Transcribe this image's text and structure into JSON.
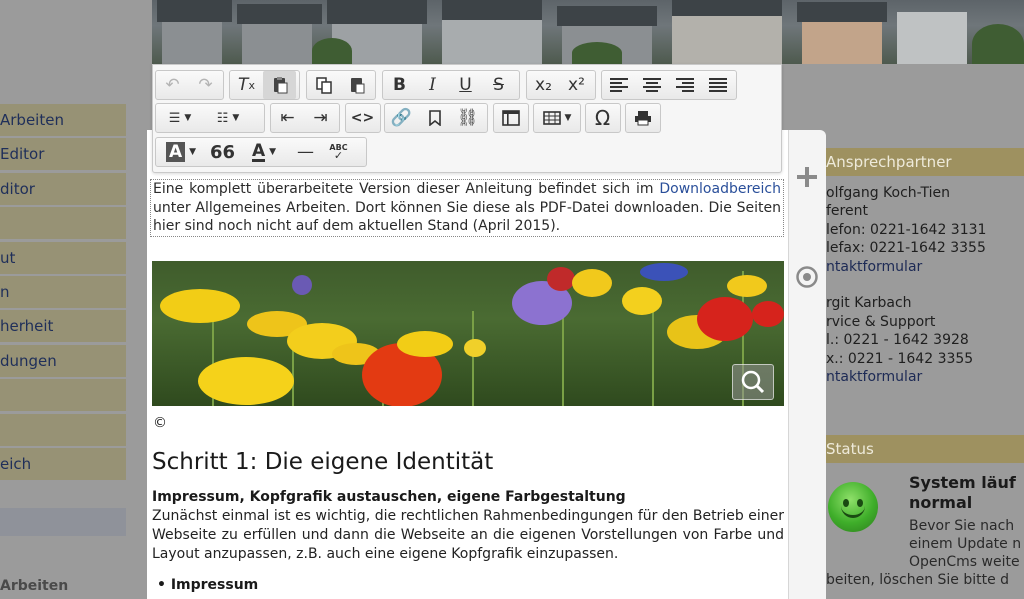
{
  "nav": {
    "items": [
      "Arbeiten",
      "Editor",
      "ditor",
      "",
      "ut",
      "n",
      "herheit",
      "dungen",
      "",
      "",
      "eich"
    ],
    "bottom": "Arbeiten"
  },
  "contact": {
    "head": "Ansprechpartner",
    "lines": [
      {
        "text": "olfgang Koch-Tien",
        "link": false
      },
      {
        "text": "ferent",
        "link": false
      },
      {
        "text": "lefon: 0221-1642 3131",
        "link": false
      },
      {
        "text": "lefax: 0221-1642 3355",
        "link": false
      },
      {
        "text": "ntaktformular",
        "link": true
      },
      {
        "text": "",
        "link": false
      },
      {
        "text": "rgit Karbach",
        "link": false
      },
      {
        "text": "rvice & Support",
        "link": false
      },
      {
        "text": "l.: 0221 - 1642 3928",
        "link": false
      },
      {
        "text": "x.: 0221 - 1642 3355",
        "link": false
      },
      {
        "text": "ntaktformular",
        "link": true
      }
    ]
  },
  "status": {
    "head": "Status",
    "title_line1": "System läuf",
    "title_line2": "normal",
    "text_line1": "Bevor Sie nach",
    "text_line2": "einem Update n",
    "text_line3": "OpenCms weite",
    "text_line4": "beiten, löschen Sie bitte d"
  },
  "toolbar": {
    "row1": [
      "undo-icon",
      "redo-icon",
      "remove-format-icon",
      "paste-icon",
      "copy-icon",
      "paste-word-icon",
      "bold-icon",
      "italic-icon",
      "underline-icon",
      "strikethrough-icon",
      "subscript-icon",
      "superscript-icon",
      "align-left-icon",
      "align-center-icon",
      "align-right-icon",
      "justify-icon"
    ],
    "bold": "B",
    "italic": "I",
    "underline": "U",
    "strike": "S",
    "sub": "x₂",
    "sup": "x²",
    "omega": "Ω",
    "quote": "66",
    "text_color": "A",
    "bg_color": "A",
    "hr": "—",
    "spell": "ABC",
    "code": "<>"
  },
  "content": {
    "notice_pre": "Eine komplett überarbeitete Version dieser Anleitung befindet sich im",
    "notice_link": "Downloadbereich",
    "notice_post": " unter Allgemeines Arbeiten. Dort können Sie diese als PDF-Datei downloaden. Die Seiten hier sind noch nicht auf dem aktuellen Stand (April 2015).",
    "copyright": "©",
    "heading": "Schritt 1: Die eigene Identität",
    "subheading": "Impressum, Kopfgrafik austauschen, eigene Farbgestaltung",
    "paragraph": "Zunächst einmal ist es wichtig, die rechtlichen Rahmenbedingungen für den Betrieb einer Webseite zu erfüllen und dann die Webseite an die eigenen Vorstellungen von Farbe und Layout anzupassen, z.B. auch eine eigene Kopfgrafik einzupassen.",
    "bullet": "Impressum"
  }
}
